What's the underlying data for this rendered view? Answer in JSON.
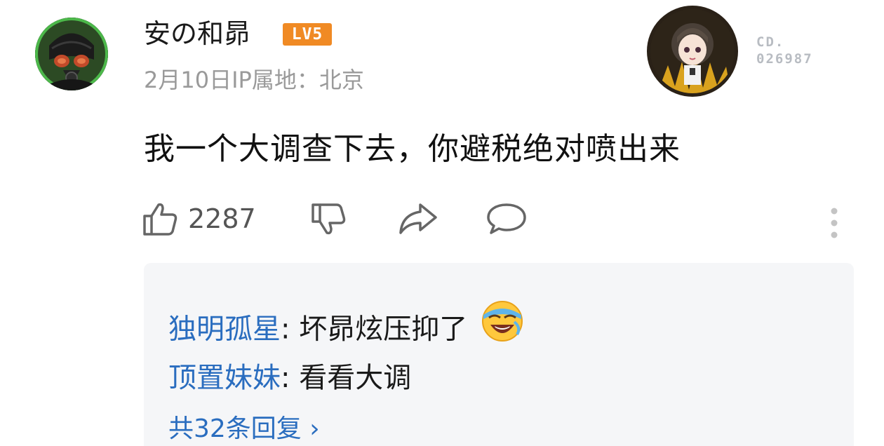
{
  "comment": {
    "username": "安の和昴",
    "level_badge": "LV5",
    "date": "2月10日",
    "ip_location": "IP属地：北京",
    "text": "我一个大调查下去，你避税绝对喷出来",
    "like_count": "2287",
    "pendant_code_line1": "CD.",
    "pendant_code_line2": "026987"
  },
  "replies": [
    {
      "name": "独明孤星",
      "text": "坏昴炫压抑了",
      "emoji": "laughing-crying-emoji"
    },
    {
      "name": "顶置妹妹",
      "text": "看看大调"
    }
  ],
  "more_replies": "共32条回复 ›",
  "colors": {
    "level_badge": "#f08a24",
    "reply_name": "#2a6dbf",
    "reply_bg": "#f5f6f8",
    "meta_text": "#9a9a9a"
  }
}
